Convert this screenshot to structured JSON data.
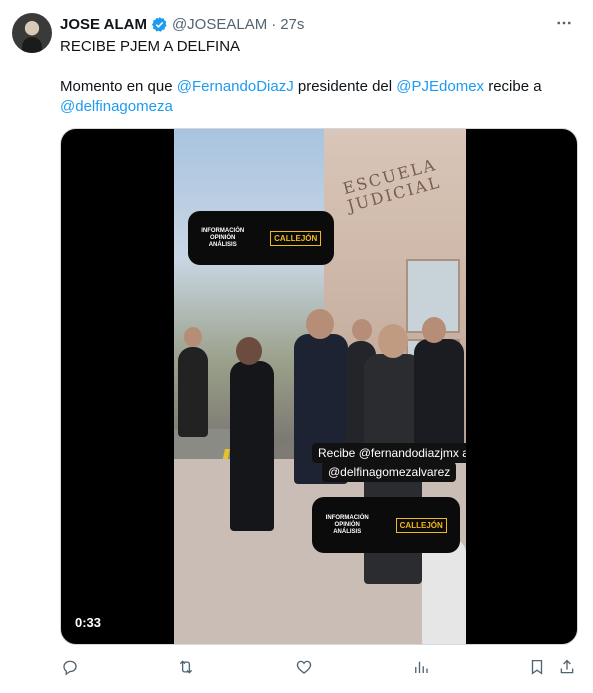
{
  "tweet": {
    "author_name": "JOSE ALAM",
    "handle": "@JOSEALAM",
    "separator": "·",
    "time": "27s",
    "headline": "RECIBE PJEM A DELFINA",
    "body": {
      "prefix": "Momento en que ",
      "mention1": "@FernandoDiazJ",
      "middle": " presidente del ",
      "mention2": "@PJEdomex",
      "suffix": " recibe a",
      "mention3": "@delfinagomeza"
    }
  },
  "video": {
    "duration": "0:33",
    "badge_top": {
      "info": "INFORMACIÓN OPINIÓN ANÁLISIS",
      "logo": "CALLEJÓN"
    },
    "badge_bottom": {
      "info": "INFORMACIÓN OPINIÓN ANÁLISIS",
      "logo": "CALLEJÓN"
    },
    "caption_line1": "Recibe @fernandodiazjmx a",
    "caption_line2": "@delfinagomezalvarez",
    "building_sign": "ESCUELA JUDICIAL"
  },
  "icons": {
    "verified": "verified-badge-icon",
    "more": "more-icon",
    "reply": "reply-icon",
    "retweet": "retweet-icon",
    "like": "like-icon",
    "views": "views-icon",
    "bookmark": "bookmark-icon",
    "share": "share-icon"
  },
  "colors": {
    "accent": "#1d9bf0",
    "text": "#0f1419",
    "muted": "#536471"
  }
}
